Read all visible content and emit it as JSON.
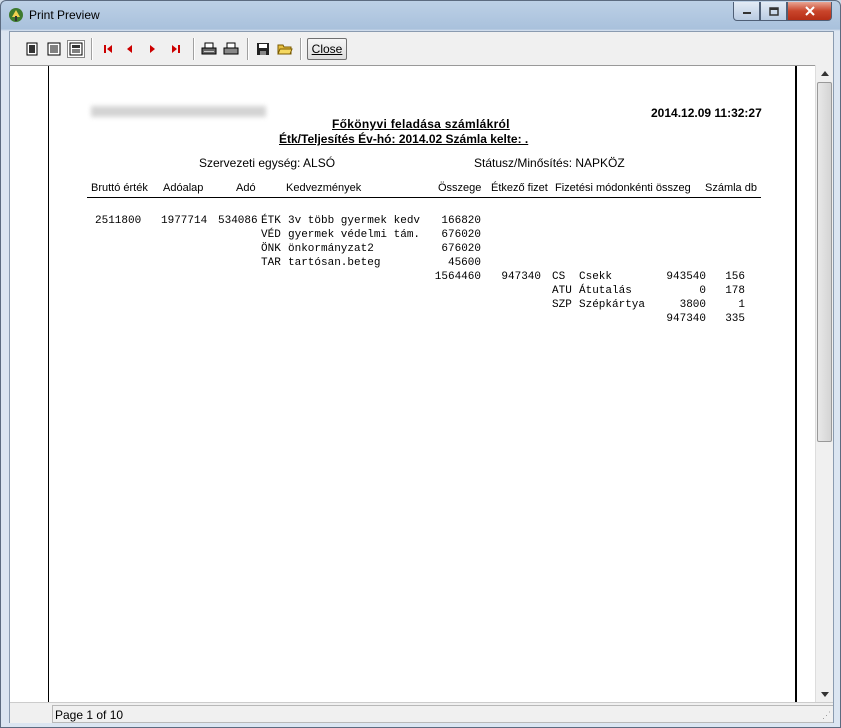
{
  "window": {
    "title": "Print Preview"
  },
  "toolbar": {
    "close_label": "Close"
  },
  "status": {
    "page_text": "Page 1 of 10"
  },
  "report": {
    "title": "Főkönyvi feladása számlákról",
    "subtitle": "Étk/Teljesítés Év-hó: 2014.02   Számla kelte:     .",
    "datetime": "2014.12.09 11:32:27",
    "org_unit": "Szervezeti egység: ALSÓ",
    "status": "Státusz/Minősítés: NAPKÖZ",
    "columns": [
      "Bruttó érték",
      "Adóalap",
      "Adó",
      "Kedvezmények",
      "Összege",
      "Étkező fizet",
      "Fizetési módonkénti összeg",
      "Számla db"
    ],
    "gross": "2511800",
    "tax_base": "1977714",
    "tax": "534086",
    "discounts": [
      {
        "code": "ÉTK",
        "name": "3v több gyermek kedv",
        "amount": "166820"
      },
      {
        "code": "VÉD",
        "name": "gyermek védelmi tám.",
        "amount": "676020"
      },
      {
        "code": "ÖNK",
        "name": "önkormányzat2",
        "amount": "676020"
      },
      {
        "code": "TAR",
        "name": "tartósan.beteg",
        "amount": "45600"
      }
    ],
    "discount_total": "1564460",
    "payer_total": "947340",
    "payments": [
      {
        "code": "CS",
        "name": "Csekk",
        "amount": "943540",
        "count": "156"
      },
      {
        "code": "ATU",
        "name": "Átutalás",
        "amount": "0",
        "count": "178"
      },
      {
        "code": "SZP",
        "name": "Szépkártya",
        "amount": "3800",
        "count": "1"
      }
    ],
    "payment_total": "947340",
    "count_total": "335"
  }
}
